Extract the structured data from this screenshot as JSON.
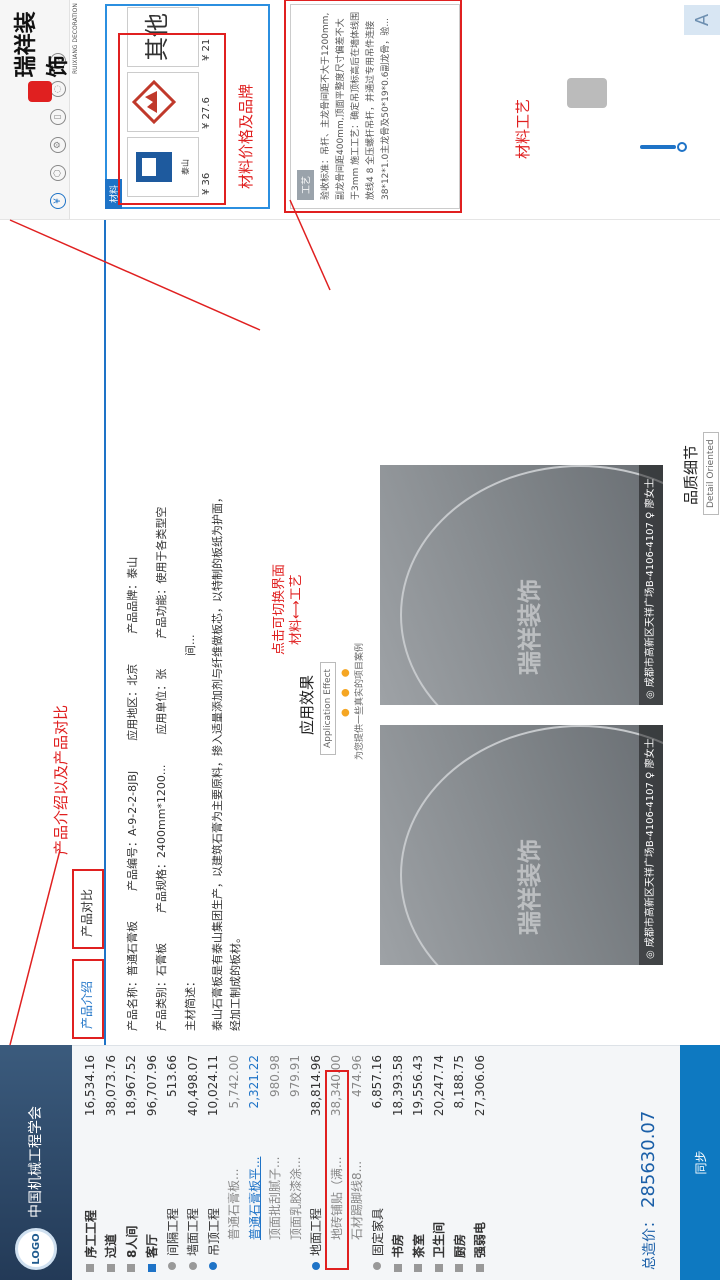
{
  "project": {
    "logo_text": "LOGO",
    "name": "中国机械工程学会"
  },
  "tree": [
    {
      "name": "序工工程",
      "value": "16,534.16",
      "level": 0,
      "dot": "square",
      "bold": true
    },
    {
      "name": "过道",
      "value": "38,073.76",
      "level": 0,
      "dot": "square",
      "bold": true
    },
    {
      "name": "8人间",
      "value": "18,967.52",
      "level": 0,
      "dot": "square",
      "bold": true
    },
    {
      "name": "客厅",
      "value": "96,707.96",
      "level": 0,
      "dot": "blue-square",
      "bold": true
    },
    {
      "name": "间隔工程",
      "value": "513.66",
      "level": 1,
      "dot": "circle"
    },
    {
      "name": "墙面工程",
      "value": "40,498.07",
      "level": 1,
      "dot": "circle"
    },
    {
      "name": "吊顶工程",
      "value": "10,024.11",
      "level": 1,
      "dot": "blue-circle"
    },
    {
      "name": "普通石膏板...",
      "value": "5,742.00",
      "level": 2
    },
    {
      "name": "普通石膏板平...",
      "value": "2,321.22",
      "level": 2,
      "highlight": true
    },
    {
      "name": "顶面批刮腻子...",
      "value": "980.98",
      "level": 2
    },
    {
      "name": "顶面乳胶漆涂...",
      "value": "979.91",
      "level": 2
    },
    {
      "name": "地面工程",
      "value": "38,814.96",
      "level": 1,
      "dot": "blue-circle"
    },
    {
      "name": "地砖铺贴（满...",
      "value": "38,340.00",
      "level": 2
    },
    {
      "name": "石材踢脚线8...",
      "value": "474.96",
      "level": 2
    },
    {
      "name": "固定家具",
      "value": "6,857.16",
      "level": 1,
      "dot": "circle"
    },
    {
      "name": "书房",
      "value": "18,393.58",
      "level": 0,
      "dot": "square",
      "bold": true
    },
    {
      "name": "茶室",
      "value": "19,556.43",
      "level": 0,
      "dot": "square",
      "bold": true
    },
    {
      "name": "卫生间",
      "value": "20,247.74",
      "level": 0,
      "dot": "square",
      "bold": true
    },
    {
      "name": "厨房",
      "value": "8,188.75",
      "level": 0,
      "dot": "square",
      "bold": true
    },
    {
      "name": "强弱电",
      "value": "27,306.06",
      "level": 0,
      "dot": "square",
      "bold": true
    }
  ],
  "summary": {
    "total_label": "总造价：",
    "total_value": "285630.07",
    "sync_label": "同步"
  },
  "tabs": {
    "intro": "产品介绍",
    "compare": "产品对比"
  },
  "annotations": {
    "intro_compare": "产品介绍以及产品对比",
    "switch": "点击可切换界面",
    "switch_2a": "材料",
    "switch_2b": "工艺",
    "material_price": "材料价格及品牌",
    "material_craft": "材料工艺"
  },
  "product": {
    "name": "产品名称：普通石膏板",
    "code": "产品编号：A-9-2-2-8JBJ",
    "region": "应用地区：北京",
    "brand": "产品品牌：泰山",
    "category": "产品类别：石膏板",
    "spec": "产品规格：2400mm*1200...",
    "unit": "应用单位：张",
    "function": "产品功能：使用于各类型空",
    "main_material": "主材简述：",
    "function_more": "间...",
    "description": "泰山石膏板是有泰山集团生产，以建筑石膏为主要原料，掺入适量添加剂与纤维做板芯，以特制的板纸为护面，经加工制成的板材。"
  },
  "application": {
    "title": "应用效果",
    "subtitle": "Application Effect",
    "note": "为您提供一些真实的项目案例",
    "photos": [
      {
        "watermark": "瑞祥装饰",
        "location": "成都市高新区天祥广场B-4106-4107 ♀ 廖女士"
      },
      {
        "watermark": "瑞祥装饰",
        "location": "成都市高新区天祥广场B-4106-4107 ♀ 廖女士"
      }
    ]
  },
  "quality": {
    "title": "品质细节",
    "subtitle": "Detail Oriented"
  },
  "materials": {
    "tag": "材料",
    "items": [
      {
        "brand_text": "泰山",
        "price": "¥ 36"
      },
      {
        "brand_text": "",
        "price": "¥ 27.6"
      },
      {
        "brand_text": "其他",
        "price": "¥ 21"
      }
    ]
  },
  "craft": {
    "tag": "工艺",
    "text": "验收标准：吊杆、主龙骨间距不大于1200mm,副龙骨间距400mm,顶面平整度尺寸偏差不大于3mm 施工工艺：确定吊顶标高后在墙体线围放线4 8 全压螺杆吊杆，并通过专用吊件连接38*12*1.0主龙骨及50*19*0.6副龙骨，验..."
  },
  "brand": {
    "name_cn": "瑞祥装饰",
    "name_en": "RUIXIANG DECORATION"
  },
  "colors": {
    "accent": "#1e73c7",
    "annotation": "#e02020",
    "sidebar_header": "#233a57"
  }
}
